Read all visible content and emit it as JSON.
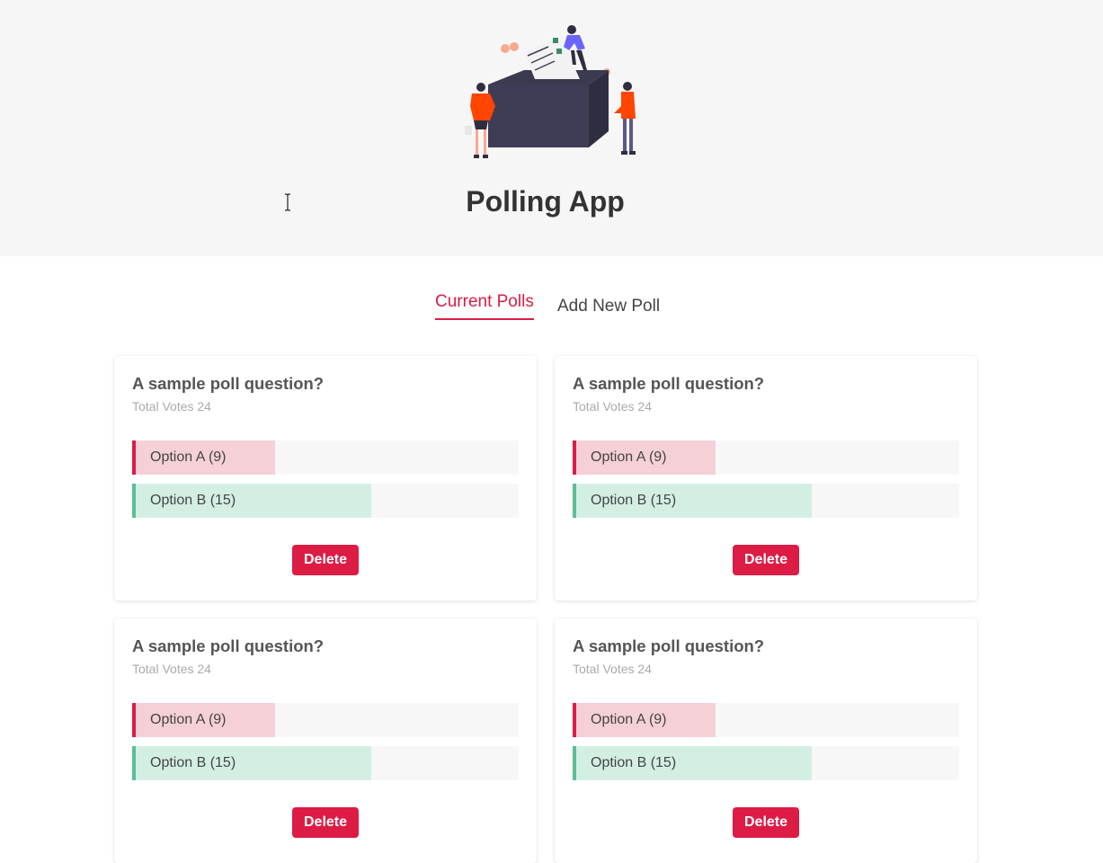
{
  "app": {
    "title": "Polling App"
  },
  "tabs": [
    {
      "label": "Current Polls",
      "active": true
    },
    {
      "label": "Add New Poll",
      "active": false
    }
  ],
  "colors": {
    "accent": "#dc1c45",
    "option_a_fill": "#f5d0d7",
    "option_b_fill": "#d3efe4",
    "option_b_border": "#5bbf96",
    "header_bg": "#f6f6f6"
  },
  "polls": [
    {
      "question": "A sample poll question?",
      "total_votes": "Total Votes 24",
      "options": [
        {
          "label": "Option A (9)",
          "votes": 9,
          "share": 0.37
        },
        {
          "label": "Option B (15)",
          "votes": 15,
          "share": 0.62
        }
      ],
      "delete_label": "Delete"
    },
    {
      "question": "A sample poll question?",
      "total_votes": "Total Votes 24",
      "options": [
        {
          "label": "Option A (9)",
          "votes": 9,
          "share": 0.37
        },
        {
          "label": "Option B (15)",
          "votes": 15,
          "share": 0.62
        }
      ],
      "delete_label": "Delete"
    },
    {
      "question": "A sample poll question?",
      "total_votes": "Total Votes 24",
      "options": [
        {
          "label": "Option A (9)",
          "votes": 9,
          "share": 0.37
        },
        {
          "label": "Option B (15)",
          "votes": 15,
          "share": 0.62
        }
      ],
      "delete_label": "Delete"
    },
    {
      "question": "A sample poll question?",
      "total_votes": "Total Votes 24",
      "options": [
        {
          "label": "Option A (9)",
          "votes": 9,
          "share": 0.37
        },
        {
          "label": "Option B (15)",
          "votes": 15,
          "share": 0.62
        }
      ],
      "delete_label": "Delete"
    }
  ]
}
